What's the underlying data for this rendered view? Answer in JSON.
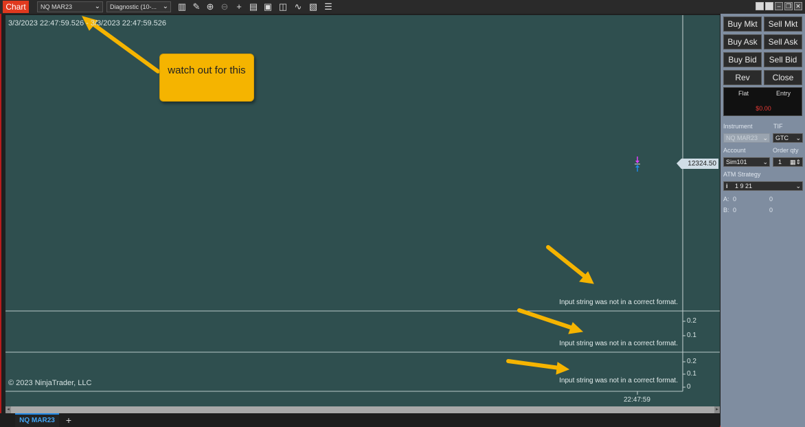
{
  "toolbar": {
    "chart_tab": "Chart",
    "instrument": "NQ MAR23",
    "template": "Diagnostic  (10-..."
  },
  "chart": {
    "time_range": "3/3/2023 22:47:59.526 - 3/3/2023 22:47:59.526",
    "copyright": "© 2023 NinjaTrader, LLC",
    "price_marker": "12324.50",
    "time_axis_label": "22:47:59",
    "panel2_ticks": [
      "0.2",
      "0.1"
    ],
    "panel3_ticks": [
      "0.2",
      "0.1",
      "0"
    ],
    "errors": [
      "Input string was not in a correct format.",
      "Input string was not in a correct format.",
      "Input string was not in a correct format."
    ],
    "callout": "watch out for this"
  },
  "tabs": {
    "active": "NQ MAR23",
    "add": "+"
  },
  "trader": {
    "buttons": {
      "buy_mkt": "Buy Mkt",
      "sell_mkt": "Sell Mkt",
      "buy_ask": "Buy Ask",
      "sell_ask": "Sell Ask",
      "buy_bid": "Buy Bid",
      "sell_bid": "Sell Bid",
      "rev": "Rev",
      "close": "Close"
    },
    "position": {
      "status": "Flat",
      "entry_label": "Entry",
      "pnl": "$0.00"
    },
    "instrument_label": "Instrument",
    "instrument_value": "NQ MAR23",
    "tif_label": "TIF",
    "tif_value": "GTC",
    "account_label": "Account",
    "account_value": "Sim101",
    "order_qty_label": "Order qty",
    "order_qty_value": "1",
    "atm_label": "ATM Strategy",
    "atm_value": "1 9 21",
    "row_a_label": "A:",
    "row_a_val1": "0",
    "row_a_val2": "0",
    "row_b_label": "B:",
    "row_b_val1": "0",
    "row_b_val2": "0"
  },
  "colors": {
    "chart_bg": "#2f4f4f",
    "chart_tab": "#e0391e",
    "callout_bg": "#f5b400",
    "arrow": "#f5b400",
    "pnl": "#e53935",
    "active_tab": "#42a5f5"
  }
}
